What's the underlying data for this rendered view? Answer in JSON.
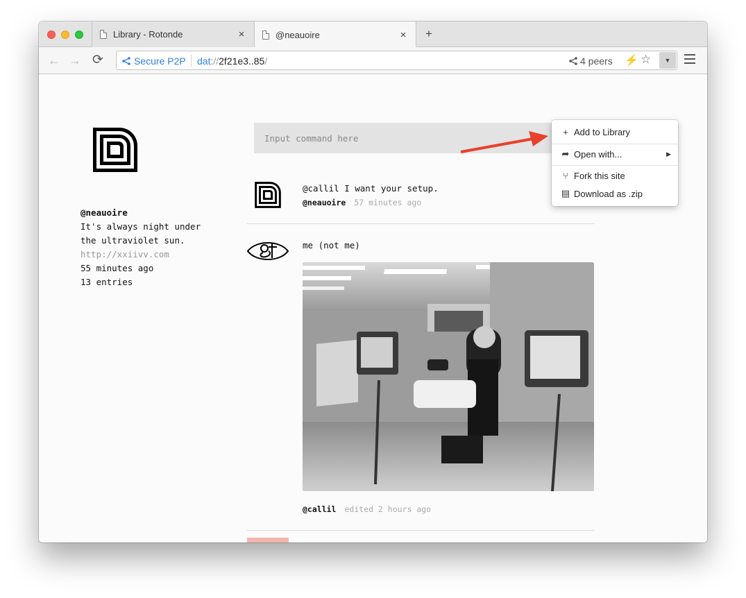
{
  "tabs": [
    {
      "title": "Library - Rotonde",
      "close": "×"
    },
    {
      "title": "@neauoire",
      "close": "×"
    }
  ],
  "new_tab_label": "+",
  "nav": {
    "back_icon": "←",
    "forward_icon": "→",
    "reload_icon": "⟳"
  },
  "urlbar": {
    "secure_label": "Secure P2P",
    "scheme": "dat:",
    "slashes": "//",
    "host": "2f21e3..85",
    "path": "/",
    "peers_label": "4 peers"
  },
  "icons": {
    "bolt": "⚡",
    "star": "☆",
    "menu_toggle": "▼",
    "share": "share-icon"
  },
  "dropdown": {
    "items": [
      {
        "icon": "+",
        "label": "Add to Library"
      },
      {
        "icon": "➦",
        "label": "Open with...",
        "submenu": "▶"
      },
      {
        "icon": "⑂",
        "label": "Fork this site"
      },
      {
        "icon": "▤",
        "label": "Download as .zip"
      }
    ]
  },
  "profile": {
    "name": "@neauoire",
    "bio_line1": "It's always night under",
    "bio_line2": "the ultraviolet sun.",
    "url": "http://xxiivv.com",
    "updated": "55 minutes ago",
    "entries": "13 entries"
  },
  "command_placeholder": "Input command here",
  "feed": [
    {
      "text": "@callil I want your setup.",
      "author": "@neauoire",
      "time": "57 minutes ago"
    },
    {
      "text": "me (not me)",
      "author": "@callil",
      "time": "edited 2 hours ago"
    }
  ],
  "colors": {
    "accent": "#2f7fe0",
    "annotation_arrow": "#e8412c",
    "pink": "#f3b5ad"
  }
}
